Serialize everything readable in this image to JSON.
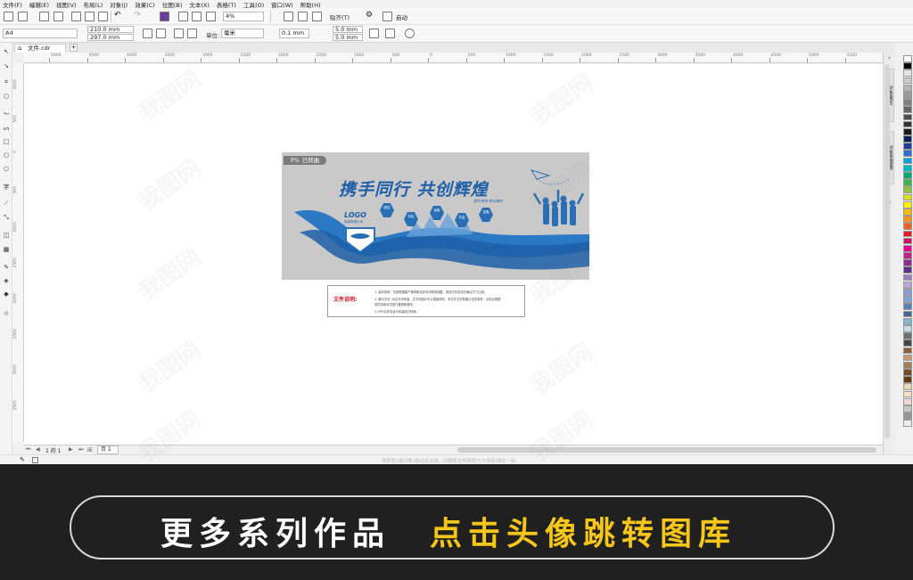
{
  "menu": [
    "文件(F)",
    "编辑(E)",
    "视图(V)",
    "布局(L)",
    "对象(J)",
    "效果(C)",
    "位图(B)",
    "文本(X)",
    "表格(T)",
    "工具(O)",
    "窗口(W)",
    "帮助(H)"
  ],
  "toolbar": {
    "zoom_value": "4%",
    "snap_label": "贴齐(T)",
    "launch_label": "启动"
  },
  "property_bar": {
    "page_size": "A4",
    "width": "210.0 mm",
    "height": "297.0 mm",
    "units_label": "单位:",
    "units_value": "毫米",
    "nudge": "0.1 mm",
    "dup_x": "5.0 mm",
    "dup_y": "5.0 mm"
  },
  "document_tab": "文件.cdr",
  "ruler_h_labels": [
    "5000",
    "4500",
    "4000",
    "3500",
    "3000",
    "2500",
    "2000",
    "1500",
    "1000",
    "500",
    "0",
    "500",
    "1000",
    "1500",
    "2000",
    "2500",
    "3000",
    "3500",
    "4000",
    "4500",
    "5000",
    "5500"
  ],
  "ruler_v_labels": [
    "1000",
    "500",
    "0",
    "500",
    "1000",
    "1500",
    "2000",
    "2500",
    "3000",
    "3500"
  ],
  "docker_tabs": [
    "对象属性",
    "对象管理器"
  ],
  "artwork": {
    "badge": "PS: 已转曲",
    "title": "携手同行  共创辉煌",
    "logo": "LOGO",
    "logo_sub": "某某有限公司",
    "hex_items": [
      "团结",
      "务实",
      "创新",
      "共赢",
      "发展"
    ],
    "slogan": "因为有你 所以精彩"
  },
  "file_note": {
    "label": "文件说明:",
    "lines": [
      "1. 素材说明：请您根据客户需求和实际情况修改调整，修改文件前请先确认尺寸比例。",
      "2. 展示文件: AI文件未转曲，文字也图片可以直接修改，本文件文字和图片仅供参考，请务必根据",
      "   您的具体情况进行替换和更改。",
      "3. EPS文件包含字体曲线已转换。"
    ]
  },
  "page_nav": {
    "counter": "1 的 1",
    "page_tab": "页 1"
  },
  "status_hint": "将颜色(或对象)拖动至此处, 以便将这些颜色与文档存储在一起",
  "watermark": "我图网",
  "palette": [
    "#ffffff",
    "#000000",
    "#e6e6e6",
    "#cccccc",
    "#b3b3b3",
    "#999999",
    "#808080",
    "#666666",
    "#4d4d4d",
    "#333333",
    "#1a1a1a",
    "#0a1f5c",
    "#1e3fa0",
    "#2c6fd1",
    "#00a0e9",
    "#00b8c8",
    "#00a870",
    "#39b54a",
    "#8cc63f",
    "#d9e021",
    "#fff200",
    "#fcb813",
    "#f7941d",
    "#f15a24",
    "#ed1c24",
    "#d4145a",
    "#ec008c",
    "#c02087",
    "#92278f",
    "#662d91",
    "#9e7cc1",
    "#b7a7d2",
    "#8d9bd0",
    "#7aa4d8",
    "#5b7fb7",
    "#44658f",
    "#8ab2c9",
    "#c6d9e5",
    "#6d6e71",
    "#444444",
    "#8c6239",
    "#c69c6d",
    "#a67c52",
    "#754c24",
    "#603813",
    "#e8d7b4",
    "#f7e3c6",
    "#f9d6d6",
    "#c8c8c8",
    "#959595",
    "#eeeeee"
  ],
  "banner": {
    "left_text": "更多系列作品",
    "right_text": "点击头像跳转图库",
    "left_color": "#ffffff",
    "right_color": "#f7c61a"
  }
}
